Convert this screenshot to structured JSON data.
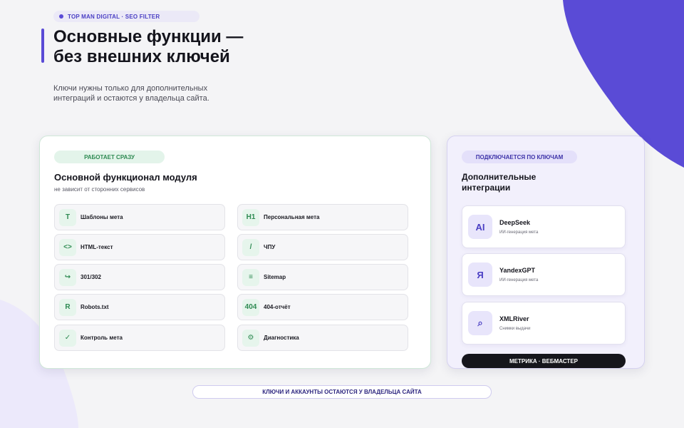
{
  "header": {
    "tag": "TOP MAN DIGITAL · SEO FILTER",
    "title_line1": "Основные функции —",
    "title_line2": "без внешних ключей",
    "subtitle_line1": "Ключи нужны только для дополнительных",
    "subtitle_line2": "интеграций и остаются у владельца сайта."
  },
  "main_card": {
    "badge": "РАБОТАЕТ СРАЗУ",
    "title": "Основной функционал модуля",
    "subtitle": "не зависит от сторонних сервисов",
    "features": [
      {
        "icon": "T",
        "label": "Шаблоны мета"
      },
      {
        "icon": "H1",
        "label": "Персональная мета"
      },
      {
        "icon": "<>",
        "label": "HTML-текст"
      },
      {
        "icon": "/",
        "label": "ЧПУ"
      },
      {
        "icon": "↪",
        "label": "301/302"
      },
      {
        "icon": "≡",
        "label": "Sitemap"
      },
      {
        "icon": "R",
        "label": "Robots.txt"
      },
      {
        "icon": "404",
        "label": "404-отчёт"
      },
      {
        "icon": "✓",
        "label": "Контроль мета"
      },
      {
        "icon": "⚙",
        "label": "Диагностика"
      }
    ]
  },
  "side_card": {
    "badge": "ПОДКЛЮЧАЕТСЯ ПО КЛЮЧАМ",
    "title_line1": "Дополнительные",
    "title_line2": "интеграции",
    "integrations": [
      {
        "icon": "AI",
        "name": "DeepSeek",
        "desc": "ИИ-генерация мета"
      },
      {
        "icon": "Я",
        "name": "YandexGPT",
        "desc": "ИИ-генерация мета"
      },
      {
        "icon": "⌕",
        "name": "XMLRiver",
        "desc": "Снимки выдачи"
      }
    ],
    "footer_pill": "МЕТРИКА · ВЕБМАСТЕР"
  },
  "bottom_note": "КЛЮЧИ И АККАУНТЫ ОСТАЮТСЯ У ВЛАДЕЛЬЦА САЙТА",
  "colors": {
    "accent": "#5a4bd6",
    "green": "#2e8a52",
    "background": "#f4f4f6"
  }
}
